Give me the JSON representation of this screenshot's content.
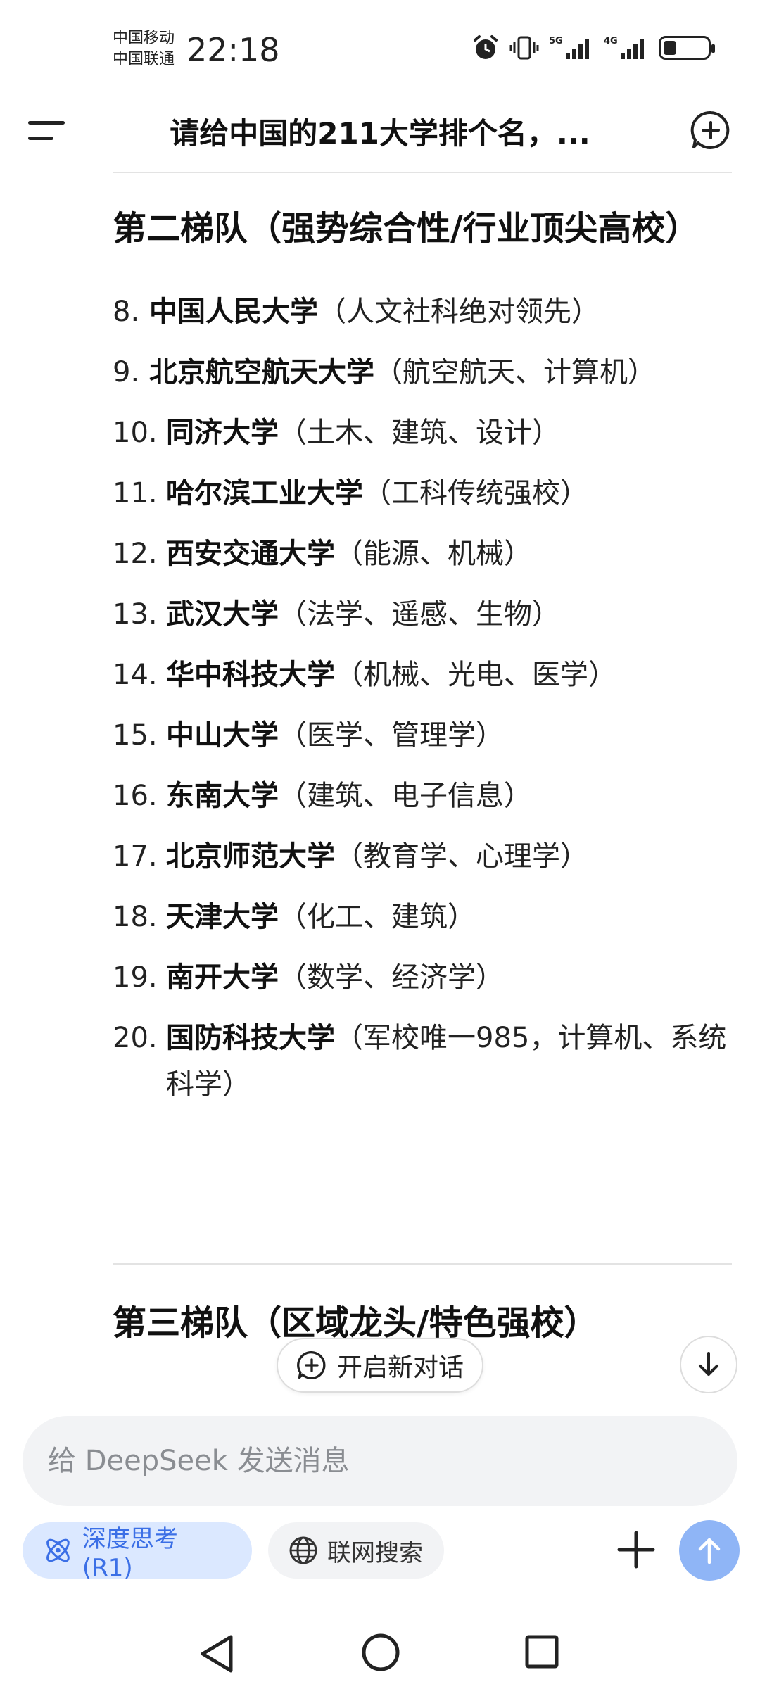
{
  "status_bar": {
    "carrier1": "中国移动",
    "carrier2": "中国联通",
    "time": "22:18",
    "net1": "5G",
    "net2": "4G"
  },
  "header": {
    "title": "请给中国的211大学排个名，..."
  },
  "content": {
    "section2_title": "第二梯队（强势综合性/行业顶尖高校）",
    "items": [
      {
        "num": "8.",
        "name": "中国人民大学",
        "note": "（人文社科绝对领先）"
      },
      {
        "num": "9.",
        "name": "北京航空航天大学",
        "note": "（航空航天、计算机）"
      },
      {
        "num": "10.",
        "name": "同济大学",
        "note": "（土木、建筑、设计）"
      },
      {
        "num": "11.",
        "name": "哈尔滨工业大学",
        "note": "（工科传统强校）"
      },
      {
        "num": "12.",
        "name": "西安交通大学",
        "note": "（能源、机械）"
      },
      {
        "num": "13.",
        "name": "武汉大学",
        "note": "（法学、遥感、生物）"
      },
      {
        "num": "14.",
        "name": "华中科技大学",
        "note": "（机械、光电、医学）"
      },
      {
        "num": "15.",
        "name": "中山大学",
        "note": "（医学、管理学）"
      },
      {
        "num": "16.",
        "name": "东南大学",
        "note": "（建筑、电子信息）"
      },
      {
        "num": "17.",
        "name": "北京师范大学",
        "note": "（教育学、心理学）"
      },
      {
        "num": "18.",
        "name": "天津大学",
        "note": "（化工、建筑）"
      },
      {
        "num": "19.",
        "name": "南开大学",
        "note": "（数学、经济学）"
      },
      {
        "num": "20.",
        "name": "国防科技大学",
        "note": "（军校唯一985，计算机、系统科学）"
      }
    ],
    "section3_title": "第三梯队（区域龙头/特色强校）"
  },
  "floating": {
    "new_chat_label": "开启新对话"
  },
  "input": {
    "placeholder": "给 DeepSeek 发送消息"
  },
  "toolbar": {
    "deep_think_label": "深度思考 (R1)",
    "web_search_label": "联网搜索"
  },
  "colors": {
    "accent": "#3b6fe6",
    "chip_bg": "#dbe8ff",
    "send_bg": "#8fb5f6"
  }
}
